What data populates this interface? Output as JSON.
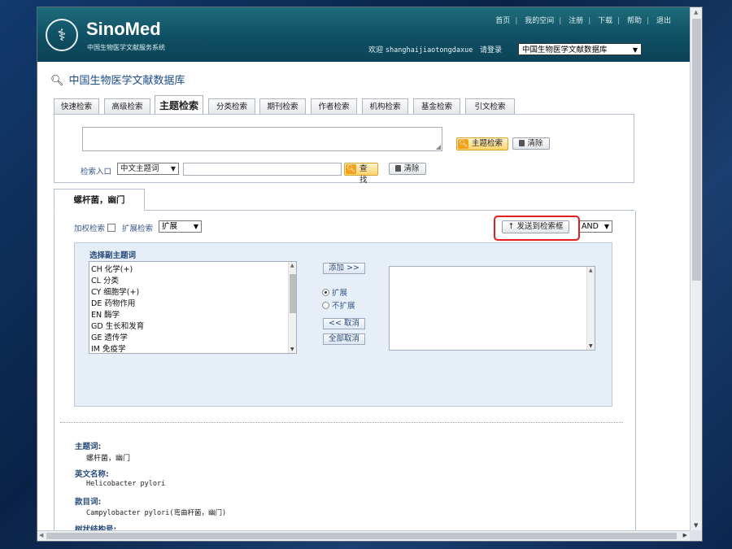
{
  "header": {
    "logo_name": "SinoMed",
    "logo_sub": "中国生物医学文献服务系统",
    "toplinks": [
      "首页",
      "我的空间",
      "注册",
      "下载",
      "帮助",
      "退出"
    ],
    "welcome_prefix": "欢迎",
    "username": "shanghaijiaotongdaxue",
    "login_label": "请登录",
    "db_selected": "中国生物医学文献数据库"
  },
  "page_title": "中国生物医学文献数据库",
  "tabs": [
    "快速检索",
    "高级检索",
    "主题检索",
    "分类检索",
    "期刊检索",
    "作者检索",
    "机构检索",
    "基金检索",
    "引文检索"
  ],
  "active_tab": "主题检索",
  "search": {
    "subject_search_btn": "主题检索",
    "clear_btn": "清除",
    "entry_label": "检索入口",
    "entry_selected": "中文主题词",
    "find_btn": "查找",
    "clear_btn2": "清除"
  },
  "result": {
    "tab_label": "螺杆菌，幽门",
    "weighted_label": "加权检索",
    "expand_label": "扩展检索",
    "expand_selected": "扩展",
    "send_btn": "发送到检索框",
    "logic_selected": "AND",
    "subheadings_title": "选择副主题词",
    "subheadings": [
      "CH 化学(+)",
      "CL 分类",
      "CY 细胞学(+)",
      "DE 药物作用",
      "EN 酶学",
      "GD 生长和发育",
      "GE 遗传学",
      "IM 免疫学"
    ],
    "add_btn": "添加 >>",
    "radio_expand": "扩展",
    "radio_no_expand": "不扩展",
    "cancel_btn": "<< 取消",
    "cancel_all_btn": "全部取消"
  },
  "details": {
    "subject_heading_label": "主题词:",
    "subject_heading": "螺杆菌，幽门",
    "english_label": "英文名称:",
    "english": "Helicobacter pylori",
    "entry_terms_label": "款目词:",
    "entry_terms": "Campylobacter pylori(弯曲杆菌，幽门)",
    "tree_label": "树状结构号:"
  },
  "colors": {
    "header_bg": "#0f4f63",
    "highlight_border": "#e21e1e",
    "link_blue": "#1b4a8a"
  }
}
